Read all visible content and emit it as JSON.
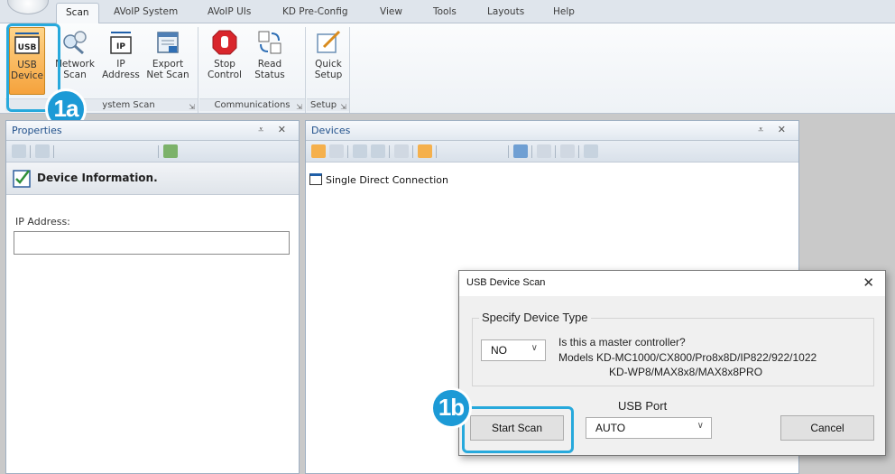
{
  "tabs": [
    "Scan",
    "AVoIP System",
    "AVoIP UIs",
    "KD Pre-Config",
    "View",
    "Tools",
    "Layouts",
    "Help"
  ],
  "ribbon": {
    "usb_device": [
      "USB",
      "Device"
    ],
    "network_scan": [
      "Network",
      "Scan"
    ],
    "ip_address": [
      "IP",
      "Address"
    ],
    "export_net_scan": [
      "Export",
      "Net Scan"
    ],
    "stop_control": [
      "Stop",
      "Control"
    ],
    "read_status": [
      "Read",
      "Status"
    ],
    "quick_setup": [
      "Quick",
      "Setup"
    ],
    "usb_icon_text": "USB",
    "ip_icon_text": "IP",
    "group_system_scan": "ystem Scan",
    "group_communications": "Communications",
    "group_setup": "Setup"
  },
  "callouts": {
    "a": "1a",
    "b": "1b"
  },
  "properties": {
    "title": "Properties",
    "pin_close": "⩡ ✕",
    "device_info": "Device Information.",
    "ip_label": "IP Address:",
    "ip_value": ""
  },
  "devices": {
    "title": "Devices",
    "pin_close": "⩡ ✕",
    "tree_item": "Single Direct Connection"
  },
  "dialog": {
    "title": "USB Device Scan",
    "close": "✕",
    "legend": "Specify Device Type",
    "type_value": "NO",
    "question": "Is this a master controller?",
    "models_line1": "Models KD-MC1000/CX800/Pro8x8D/IP822/922/1022",
    "models_line2": "KD-WP8/MAX8x8/MAX8x8PRO",
    "usb_port_label": "USB Port",
    "usb_port_value": "AUTO",
    "start_scan": "Start Scan",
    "cancel": "Cancel"
  },
  "colors": {
    "accent": "#1c9ad6",
    "selected": "#f5a23c",
    "panel_title": "#1f4f8a"
  }
}
